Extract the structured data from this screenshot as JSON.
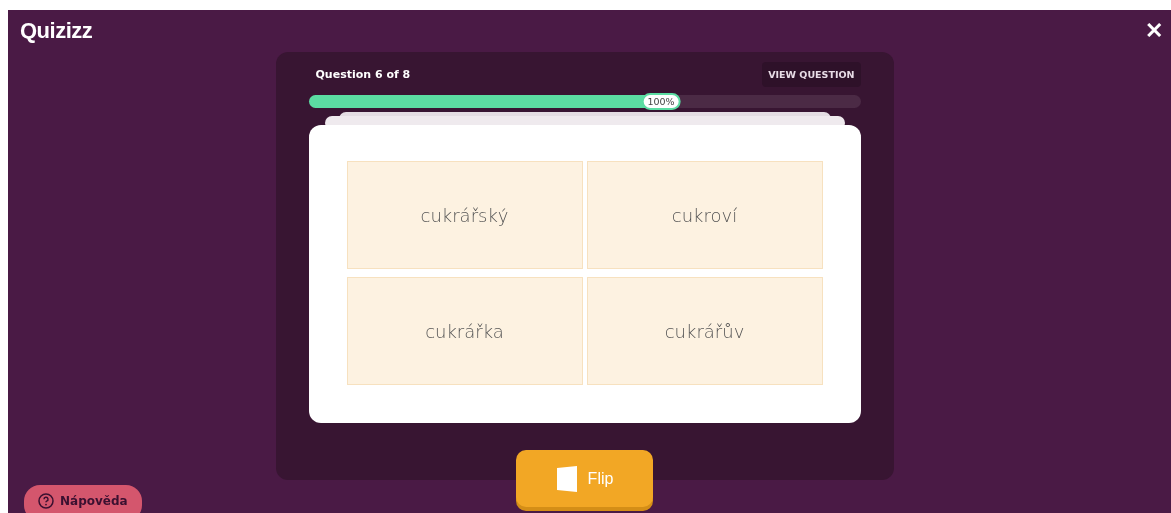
{
  "logo": "Quizizz",
  "close": "✕",
  "header": {
    "question": "Question 6 of 8",
    "view_button": "VIEW QUESTION"
  },
  "progress": {
    "level": 0.66,
    "label": "100%"
  },
  "options": [
    {
      "text": "cukrářský"
    },
    {
      "text": "cukroví"
    },
    {
      "text": "cukrářka"
    },
    {
      "text": "cukrářův"
    }
  ],
  "flip_button": "Flip",
  "help_button": "Nápověda"
}
